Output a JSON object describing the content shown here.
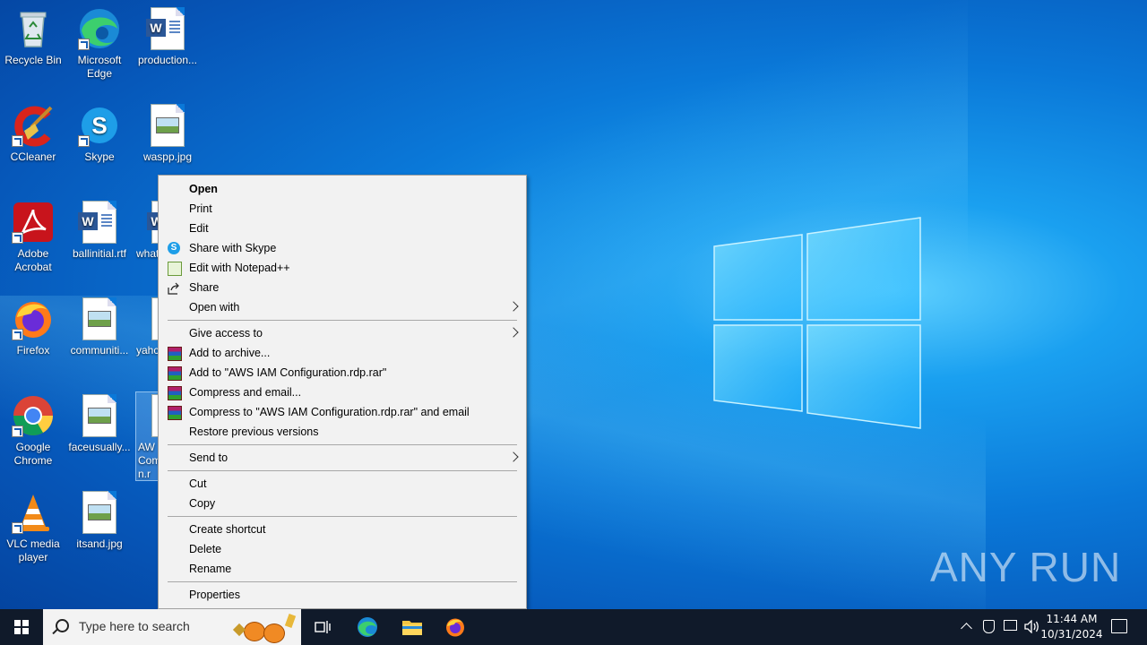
{
  "desktop": {
    "icons": [
      {
        "label": "Recycle Bin"
      },
      {
        "label": "Microsoft Edge"
      },
      {
        "label": "production..."
      },
      {
        "label": "CCleaner"
      },
      {
        "label": "Skype"
      },
      {
        "label": "waspp.jpg"
      },
      {
        "label": "Adobe Acrobat"
      },
      {
        "label": "ballinitial.rtf"
      },
      {
        "label": "what"
      },
      {
        "label": "Firefox"
      },
      {
        "label": "communiti..."
      },
      {
        "label": "yahc"
      },
      {
        "label": "Google Chrome"
      },
      {
        "label": "faceusually..."
      },
      {
        "label": "AW Com n.r"
      },
      {
        "label": "VLC media player"
      },
      {
        "label": "itsand.jpg"
      }
    ]
  },
  "context_menu": {
    "items": [
      {
        "label": "Open"
      },
      {
        "label": "Print"
      },
      {
        "label": "Edit"
      },
      {
        "label": "Share with Skype"
      },
      {
        "label": "Edit with Notepad++"
      },
      {
        "label": "Share"
      },
      {
        "label": "Open with"
      },
      {
        "label": "Give access to"
      },
      {
        "label": "Add to archive..."
      },
      {
        "label": "Add to \"AWS IAM Configuration.rdp.rar\""
      },
      {
        "label": "Compress and email..."
      },
      {
        "label": "Compress to \"AWS IAM Configuration.rdp.rar\" and email"
      },
      {
        "label": "Restore previous versions"
      },
      {
        "label": "Send to"
      },
      {
        "label": "Cut"
      },
      {
        "label": "Copy"
      },
      {
        "label": "Create shortcut"
      },
      {
        "label": "Delete"
      },
      {
        "label": "Rename"
      },
      {
        "label": "Properties"
      }
    ]
  },
  "taskbar": {
    "search_placeholder": "Type here to search",
    "clock_time": "11:44 AM",
    "clock_date": "10/31/2024"
  },
  "watermark": "ANY RUN",
  "colors": {
    "accent": "#0a78d8",
    "taskbar": "#101a2a",
    "menu_bg": "#f2f2f2"
  }
}
